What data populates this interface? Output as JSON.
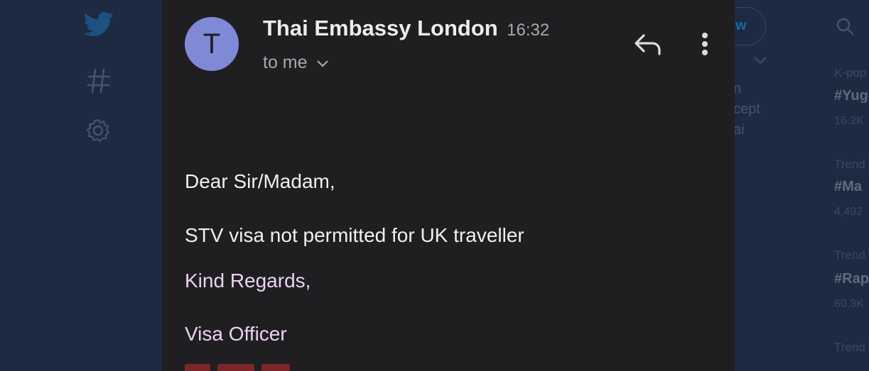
{
  "background": {
    "follow_button_text": "w",
    "tweet_fragments": [
      "n",
      "cept",
      "ai"
    ],
    "trends": [
      {
        "category": "K-pop",
        "tag": "#Yug",
        "count": "16.2K"
      },
      {
        "category": "Trend",
        "tag": "#Ma",
        "count": "4,492"
      },
      {
        "category": "Trend",
        "tag": "#Rap",
        "count": "60.3K"
      },
      {
        "category": "Trend",
        "tag": "",
        "count": ""
      }
    ]
  },
  "email": {
    "avatar_initial": "T",
    "sender_name": "Thai Embassy London",
    "time": "16:32",
    "recipient": "to me",
    "body": {
      "greeting": "Dear Sir/Madam,",
      "message": "STV visa not permitted for UK traveller",
      "closing": "Kind Regards,",
      "signature": "Visa Officer"
    },
    "colors": {
      "panel_bg": "#1f1f21",
      "avatar_bg": "#7f89d6",
      "signature_text": "#ecd2f0"
    }
  }
}
